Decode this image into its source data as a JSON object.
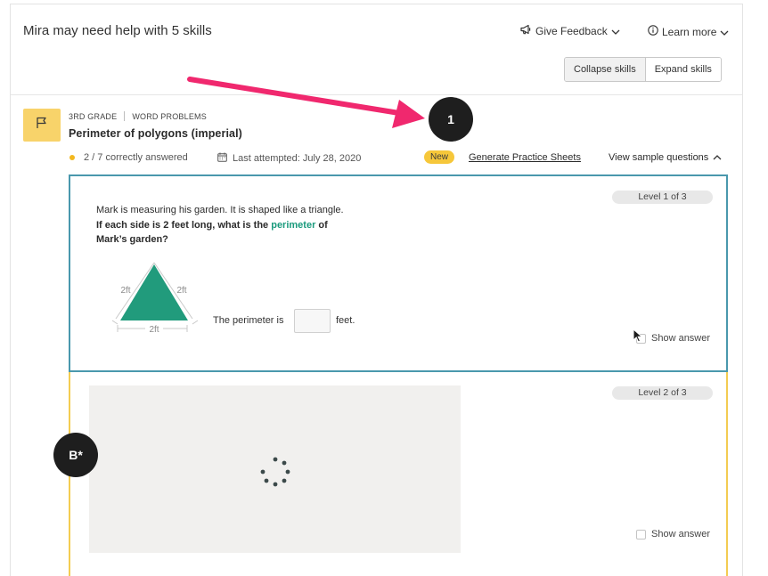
{
  "header": {
    "title": "Mira may need help with 5 skills",
    "feedback_label": "Give Feedback",
    "learn_more_label": "Learn more",
    "collapse_label": "Collapse skills",
    "expand_label": "Expand skills"
  },
  "skill": {
    "grade": "3RD GRADE",
    "category": "WORD PROBLEMS",
    "title": "Perimeter of polygons (imperial)",
    "score": "2 / 7 correctly answered",
    "last_attempted": "Last attempted: July 28, 2020",
    "badge_new": "New",
    "generate_link": "Generate Practice Sheets",
    "view_sample": "View sample questions"
  },
  "question1": {
    "level": "Level 1 of 3",
    "line1": "Mark is measuring his garden. It is shaped like a triangle.",
    "line2_a": "If each side is 2 feet long, what is the ",
    "line2_kw": "perimeter",
    "line2_b": " of",
    "line3": "Mark’s garden?",
    "side_left": "2ft",
    "side_right": "2ft",
    "side_bottom": "2ft",
    "perimeter_prefix": "The perimeter is",
    "perimeter_suffix": "feet.",
    "show_answer": "Show answer"
  },
  "question2": {
    "level": "Level 2 of 3",
    "show_answer": "Show answer"
  },
  "callouts": {
    "one": "1",
    "b": "B*"
  },
  "colors": {
    "accent_teal": "#1a9a7c",
    "card_border_blue": "#4a98ad",
    "card_border_yellow": "#f3cc52",
    "flag_tile": "#f8d36a",
    "arrow": "#f0286e"
  },
  "icons": {
    "feedback": "megaphone-icon",
    "learn_more": "info-icon",
    "flag": "flag-icon",
    "calendar": "calendar-icon",
    "spinner": "loading-spinner-icon"
  }
}
